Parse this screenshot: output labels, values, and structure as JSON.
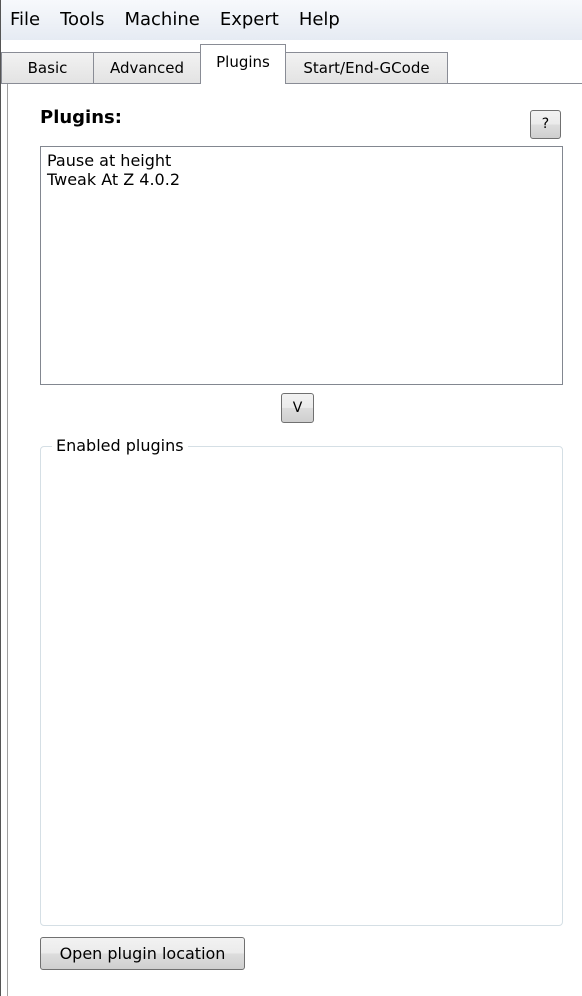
{
  "menubar": {
    "items": [
      "File",
      "Tools",
      "Machine",
      "Expert",
      "Help"
    ]
  },
  "tabs": {
    "items": [
      "Basic",
      "Advanced",
      "Plugins",
      "Start/End-GCode"
    ],
    "active": "Plugins"
  },
  "plugins_panel": {
    "heading": "Plugins:",
    "help_button_label": "?",
    "available_plugins": [
      "Pause at height",
      "Tweak At Z 4.0.2"
    ],
    "move_button_label": "V",
    "enabled_group_label": "Enabled plugins",
    "enabled_plugins": [],
    "open_location_button_label": "Open plugin location"
  }
}
